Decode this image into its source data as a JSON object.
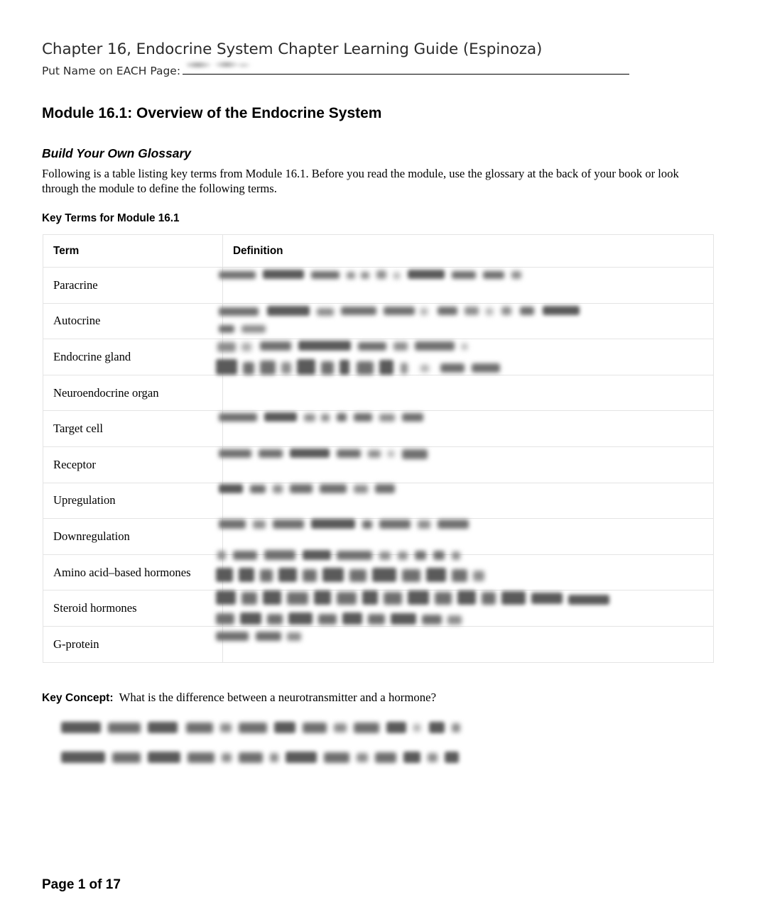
{
  "document": {
    "title": "Chapter 16, Endocrine System Chapter Learning Guide (Espinoza)",
    "name_prompt": "Put Name on EACH Page:",
    "name_value_redacted": "",
    "footer": "Page 1 of 17"
  },
  "module": {
    "heading": "Module 16.1: Overview of the Endocrine System"
  },
  "glossary": {
    "heading": "Build Your Own Glossary",
    "intro": "Following is a table listing key terms from Module 16.1. Before you read the module, use the glossary at the back of your book or look through the module to define the following terms.",
    "table_label": "Key Terms for Module 16.1",
    "columns": [
      "Term",
      "Definition"
    ],
    "rows": [
      {
        "term": "Paracrine",
        "definition": ""
      },
      {
        "term": "Autocrine",
        "definition": ""
      },
      {
        "term": "Endocrine gland",
        "definition": ""
      },
      {
        "term": "Neuroendocrine organ",
        "definition": ""
      },
      {
        "term": "Target cell",
        "definition": ""
      },
      {
        "term": "Receptor",
        "definition": ""
      },
      {
        "term": "Upregulation",
        "definition": ""
      },
      {
        "term": "Downregulation",
        "definition": ""
      },
      {
        "term": "Amino acid–based hormones",
        "definition": ""
      },
      {
        "term": "Steroid hormones",
        "definition": ""
      },
      {
        "term": "G-protein",
        "definition": ""
      }
    ]
  },
  "key_concept": {
    "label": "Key Concept:",
    "question": "What is the difference between a neurotransmitter and a hormone?",
    "answer_redacted": ""
  },
  "colors": {
    "text": "#000000",
    "header_text": "#2b2b2b",
    "table_border": "#e4e4e4",
    "redaction_ink": "#6f6f6f"
  }
}
